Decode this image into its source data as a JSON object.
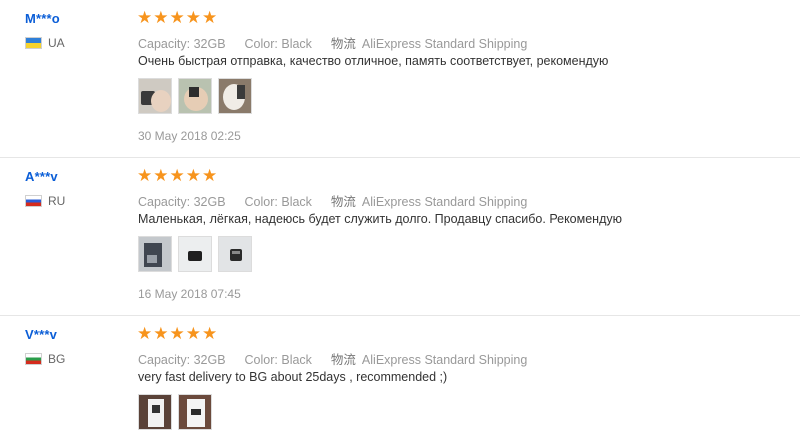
{
  "labels": {
    "capacity": "Capacity:",
    "color": "Color:",
    "shipping_company_glyph": "物流"
  },
  "reviews": [
    {
      "user": "M***o",
      "country": "UA",
      "flag_colors": [
        "#2f7fd8",
        "#f6d32d"
      ],
      "stars": 5,
      "capacity": "32GB",
      "color": "Black",
      "shipping": "AliExpress Standard Shipping",
      "text": "Очень быстрая отправка, качество отличное, память соответствует, рекомендую",
      "photo_count": 3,
      "date": "30 May 2018 02:25"
    },
    {
      "user": "A***v",
      "country": "RU",
      "flag_colors": [
        "#ffffff",
        "#2a5bd7",
        "#d52b1e"
      ],
      "stars": 5,
      "capacity": "32GB",
      "color": "Black",
      "shipping": "AliExpress Standard Shipping",
      "text": "Маленькая, лёгкая, надеюсь будет служить долго. Продавцу спасибо. Рекомендую",
      "photo_count": 3,
      "date": "16 May 2018 07:45"
    },
    {
      "user": "V***v",
      "country": "BG",
      "flag_colors": [
        "#ffffff",
        "#2a9d4a",
        "#d52b1e"
      ],
      "stars": 5,
      "capacity": "32GB",
      "color": "Black",
      "shipping": "AliExpress Standard Shipping",
      "text": "very fast delivery to BG about 25days , recommended ;)",
      "photo_count": 2,
      "date": ""
    }
  ],
  "colors": {
    "username": "#0b5ed7",
    "star": "#f7941d",
    "muted": "#999999",
    "divider": "#e6e6e6"
  }
}
